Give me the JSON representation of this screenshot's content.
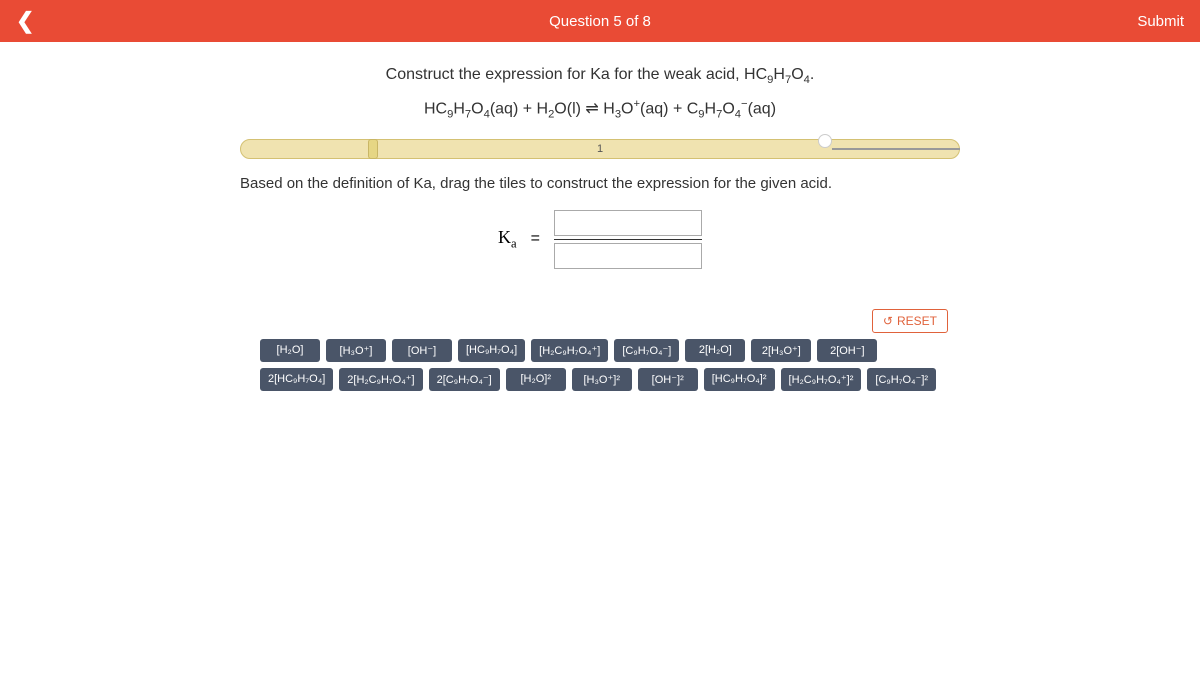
{
  "header": {
    "title": "Question 5 of 8",
    "submit": "Submit"
  },
  "prompt": {
    "line1_pre": "Construct the expression for Ka for the weak acid, HC",
    "line1_formula_rest": "H₇O₄.",
    "equation": "HC₉H₇O₄(aq) + H₂O(l) ⇌ H₃O⁺(aq) + C₉H₇O₄⁻(aq)"
  },
  "progress": {
    "current": "1"
  },
  "instruction": "Based on the definition of Ka, drag the tiles to construct the expression for the given acid.",
  "expression": {
    "ka": "Ka",
    "equals": "="
  },
  "reset": "RESET",
  "tiles": [
    "[H₂O]",
    "[H₃O⁺]",
    "[OH⁻]",
    "[HC₉H₇O₄]",
    "[H₂C₉H₇O₄⁺]",
    "[C₉H₇O₄⁻]",
    "2[H₂O]",
    "2[H₃O⁺]",
    "2[OH⁻]",
    "2[HC₉H₇O₄]",
    "2[H₂C₉H₇O₄⁺]",
    "2[C₉H₇O₄⁻]",
    "[H₂O]²",
    "[H₃O⁺]²",
    "[OH⁻]²",
    "[HC₉H₇O₄]²",
    "[H₂C₉H₇O₄⁺]²",
    "[C₉H₇O₄⁻]²"
  ]
}
